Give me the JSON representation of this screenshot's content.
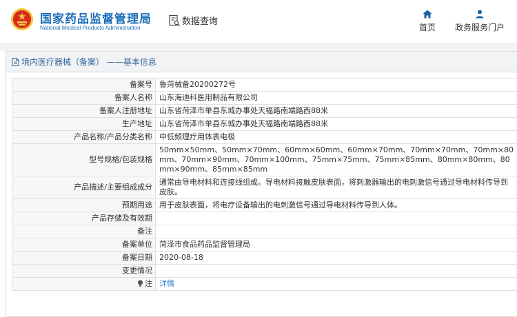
{
  "header": {
    "brand_cn": "国家药品监督管理局",
    "brand_en": "National Medical Products Administration",
    "query_label": "数据查询",
    "nav": [
      {
        "label": "首页",
        "icon": "home-icon"
      },
      {
        "label": "政务服务门户",
        "icon": "user-icon"
      }
    ]
  },
  "panel": {
    "title": "境内医疗器械（备案） ——基本信息",
    "icon": "document-icon"
  },
  "record": {
    "rows": [
      {
        "key": "备案号",
        "value": "鲁菏械备20200272号"
      },
      {
        "key": "备案人名称",
        "value": "山东海迪科医用制品有限公司"
      },
      {
        "key": "备案人注册地址",
        "value": "山东省菏泽市单县东城办事处天福路南端路西88米"
      },
      {
        "key": "生产地址",
        "value": "山东省菏泽市单县东城办事处天福路南端路西88米"
      },
      {
        "key": "产品名称/产品分类名称",
        "value": "中低频理疗用体表电极"
      },
      {
        "key": "型号规格/包装规格",
        "value": "50mm×50mm、50mm×70mm、60mm×60mm、60mm×70mm、70mm×70mm、70mm×80mm、70mm×90mm、70mm×100mm、75mm×75mm、75mm×85mm、80mm×80mm、80mm×90mm、85mm×85mm"
      },
      {
        "key": "产品描述/主要组成成分",
        "value": "通常由导电材料和连接线组成。导电材料接触皮肤表面，将刺激器输出的电刺激信号通过导电材料传导到皮肤。"
      },
      {
        "key": "预期用途",
        "value": "用于皮肤表面，将电疗设备输出的电刺激信号通过导电材料传导到人体。"
      },
      {
        "key": "产品存储及有效期",
        "value": ""
      },
      {
        "key": "备注",
        "value": ""
      },
      {
        "key": "备案单位",
        "value": "菏泽市食品药品监督管理局"
      },
      {
        "key": "备案日期",
        "value": "2020-08-18"
      },
      {
        "key": "变更情况",
        "value": ""
      }
    ],
    "note_key": "注",
    "note_link": "详情"
  },
  "colors": {
    "brand_blue": "#1e6fb8",
    "nav_icon_blue": "#1f5fa8",
    "link_blue": "#2a7bd0",
    "emblem_red": "#d8281e",
    "emblem_gold": "#f2c53d"
  }
}
